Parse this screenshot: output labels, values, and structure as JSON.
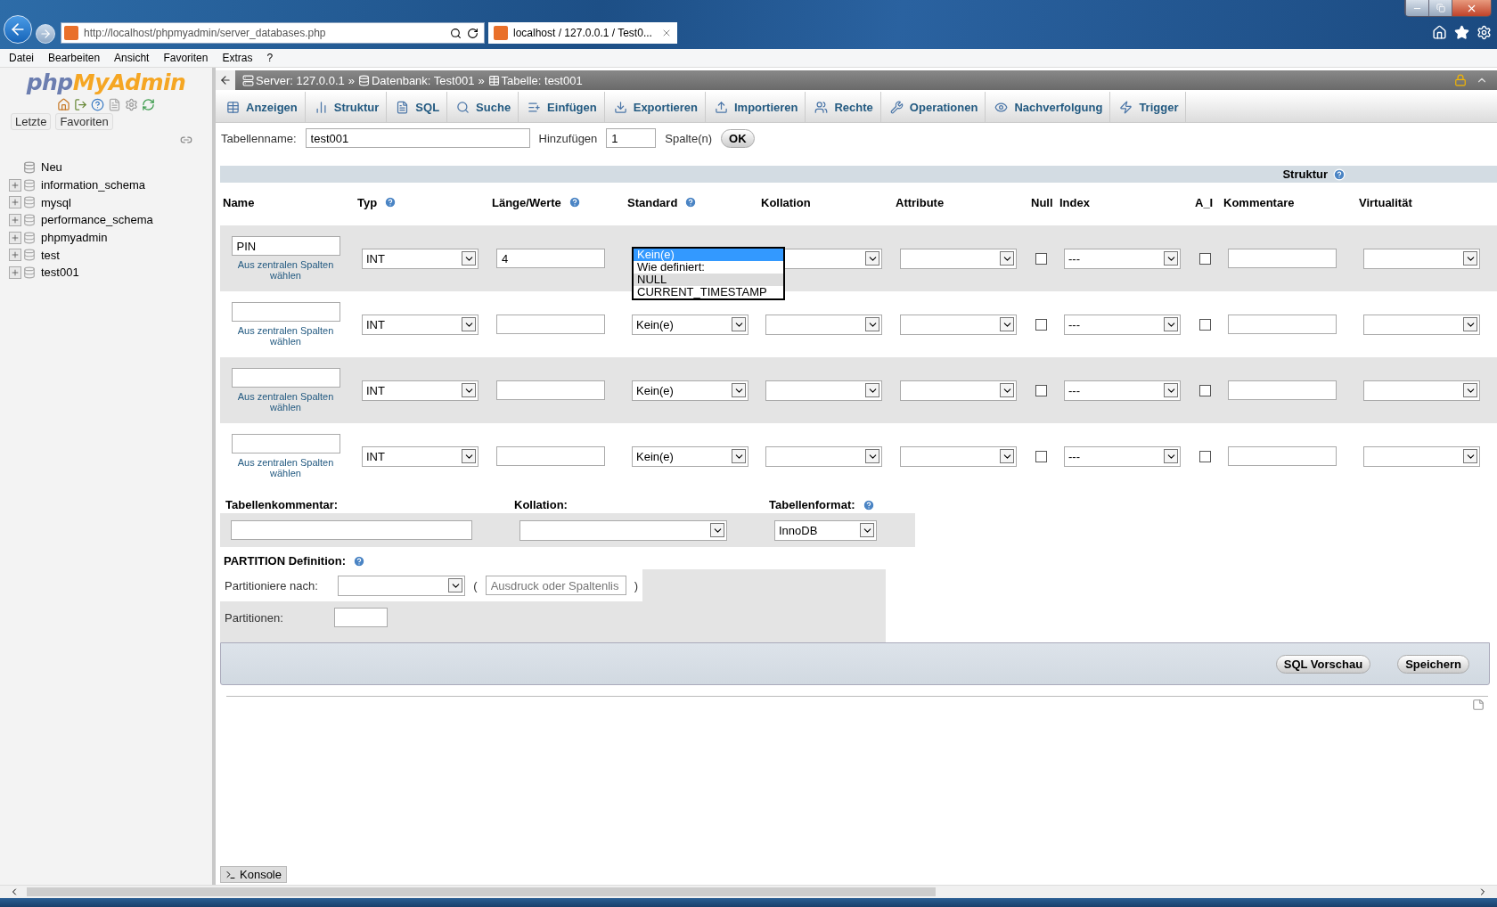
{
  "browser": {
    "address": "http://localhost/phpmyadmin/server_databases.php",
    "tab_title": "localhost / 127.0.0.1 / Test0...",
    "menu": [
      "Datei",
      "Bearbeiten",
      "Ansicht",
      "Favoriten",
      "Extras",
      "?"
    ]
  },
  "sidebar": {
    "logo_first": "php",
    "logo_second": "MyAdmin",
    "buttons": [
      "Letzte",
      "Favoriten"
    ],
    "tree": [
      {
        "label": "Neu",
        "kind": "new"
      },
      {
        "label": "information_schema",
        "kind": "database"
      },
      {
        "label": "mysql",
        "kind": "database"
      },
      {
        "label": "performance_schema",
        "kind": "database"
      },
      {
        "label": "phpmyadmin",
        "kind": "database"
      },
      {
        "label": "test",
        "kind": "database"
      },
      {
        "label": "test001",
        "kind": "database"
      }
    ]
  },
  "breadcrumb": [
    {
      "label": "Server: 127.0.0.1",
      "kind": "server",
      "separator": "»"
    },
    {
      "label": "Datenbank: Test001",
      "kind": "database",
      "separator": "»"
    },
    {
      "label": "Tabelle: test001",
      "kind": "table"
    }
  ],
  "tabs": [
    {
      "label": "Anzeigen",
      "kind": "browse",
      "selected": false
    },
    {
      "label": "Struktur",
      "kind": "structure",
      "selected": false
    },
    {
      "label": "SQL",
      "kind": "sql",
      "selected": false
    },
    {
      "label": "Suche",
      "kind": "search",
      "selected": false
    },
    {
      "label": "Einfügen",
      "kind": "insert",
      "selected": false
    },
    {
      "label": "Exportieren",
      "kind": "export",
      "selected": false
    },
    {
      "label": "Importieren",
      "kind": "import",
      "selected": false
    },
    {
      "label": "Rechte",
      "kind": "privileges",
      "selected": false
    },
    {
      "label": "Operationen",
      "kind": "operations",
      "selected": false
    },
    {
      "label": "Nachverfolgung",
      "kind": "tracking",
      "selected": false
    },
    {
      "label": "Trigger",
      "kind": "triggers",
      "selected": false
    }
  ],
  "table_form": {
    "name_label": "Tabellenname:",
    "name_value": "test001",
    "add_label": "Hinzufügen",
    "add_value": "1",
    "add_unit": "Spalte(n)",
    "ok": "OK"
  },
  "structure": {
    "title": "Struktur",
    "columns": [
      {
        "label": "Name",
        "help": false
      },
      {
        "label": "Typ",
        "help": true
      },
      {
        "label": "Länge/Werte",
        "help": true
      },
      {
        "label": "Standard",
        "help": true
      },
      {
        "label": "Kollation",
        "help": false
      },
      {
        "label": "Attribute",
        "help": false
      },
      {
        "label": "Null",
        "help": false
      },
      {
        "label": "Index",
        "help": false
      },
      {
        "label": "A_I",
        "help": false
      },
      {
        "label": "Kommentare",
        "help": false
      },
      {
        "label": "Virtualität",
        "help": false
      }
    ],
    "rows": [
      {
        "name": "PIN",
        "central_link": "Aus zentralen Spalten wählen",
        "type": "INT",
        "length": "4",
        "default_options": [
          {
            "label": "Kein(e)",
            "selected": true,
            "hovered": false
          },
          {
            "label": "Wie definiert:",
            "selected": false,
            "hovered": false
          },
          {
            "label": "NULL",
            "selected": false,
            "hovered": true
          },
          {
            "label": "CURRENT_TIMESTAMP",
            "selected": false,
            "hovered": false
          }
        ],
        "null": false,
        "index": "---",
        "ai": false
      },
      {
        "central_link": "Aus zentralen Spalten wählen",
        "type": "INT",
        "default": "Kein(e)",
        "null": false,
        "index": "---",
        "ai": false
      },
      {
        "central_link": "Aus zentralen Spalten wählen",
        "type": "INT",
        "default": "Kein(e)",
        "null": false,
        "index": "---",
        "ai": false
      },
      {
        "central_link": "Aus zentralen Spalten wählen",
        "type": "INT",
        "default": "Kein(e)",
        "null": false,
        "index": "---",
        "ai": false
      }
    ]
  },
  "table_options": {
    "comment_label": "Tabellenkommentar:",
    "collation_label": "Kollation:",
    "engine_label": "Tabellenformat:",
    "engine_value": "InnoDB"
  },
  "partition": {
    "title": "PARTITION Definition:",
    "by_label": "Partitioniere nach:",
    "open_paren": "(",
    "expression_placeholder": "Ausdruck oder Spaltenlis",
    "close_paren": ")",
    "count_label": "Partitionen:"
  },
  "actions": [
    "SQL Vorschau",
    "Speichern"
  ],
  "console": "Konsole"
}
